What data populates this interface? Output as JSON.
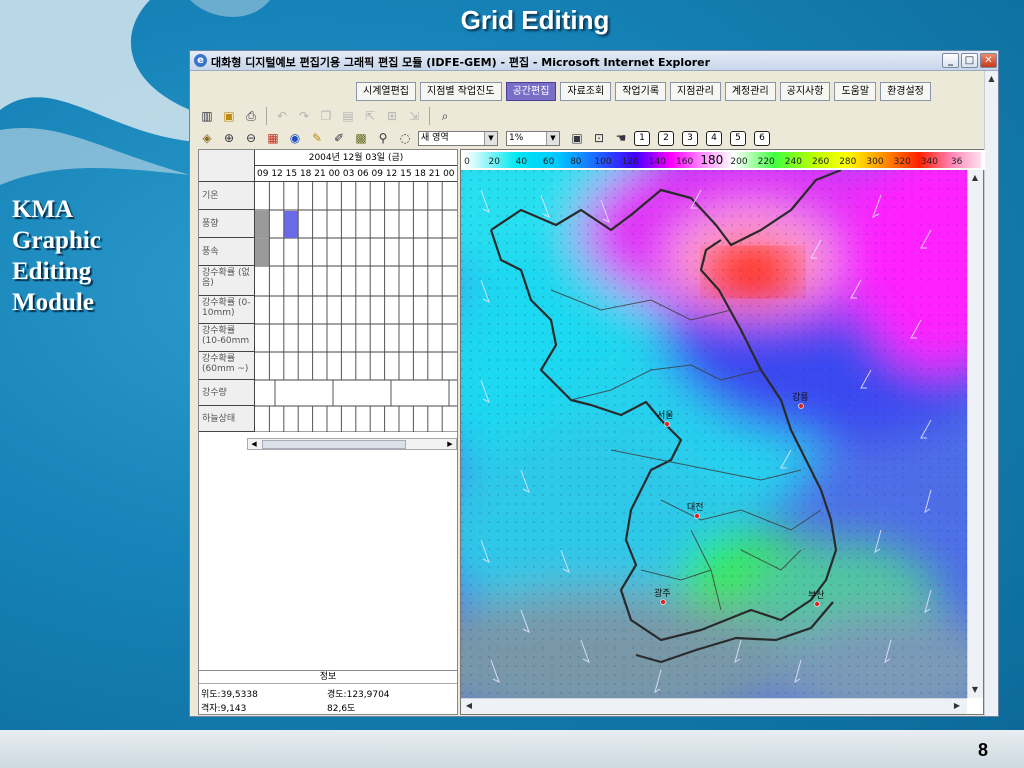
{
  "slide": {
    "title": "Grid Editing",
    "side_title_lines": [
      "KMA",
      "Graphic",
      "Editing",
      "Module"
    ],
    "page_number": "8"
  },
  "window": {
    "title": "대화형 디지털예보 편집기용 그래픽 편집 모듈 (IDFE-GEM) - 편집 - Microsoft Internet Explorer",
    "controls": {
      "minimize": "_",
      "maximize": "□",
      "close": "✕"
    }
  },
  "tabs": [
    {
      "label": "시계열편집",
      "active": false
    },
    {
      "label": "지점별 작업진도",
      "active": false
    },
    {
      "label": "공간편집",
      "active": true
    },
    {
      "label": "자료조회",
      "active": false
    },
    {
      "label": "작업기록",
      "active": false
    },
    {
      "label": "지점관리",
      "active": false
    },
    {
      "label": "계정관리",
      "active": false
    },
    {
      "label": "공지사항",
      "active": false
    },
    {
      "label": "도움말",
      "active": false
    },
    {
      "label": "환경설정",
      "active": false
    }
  ],
  "toolbar": {
    "region_select": "새 영역",
    "percent_select": "1%",
    "number_buttons": [
      "1",
      "2",
      "3",
      "4",
      "5",
      "6"
    ]
  },
  "timeseries": {
    "date": "2004년 12월 03일 (금)",
    "hours": "09 12 15 18 21 00 03 06 09 12 15 18 21 00",
    "rows": [
      {
        "label": "기온"
      },
      {
        "label": "풍향"
      },
      {
        "label": "풍속"
      },
      {
        "label": "강수확률 (없음)"
      },
      {
        "label": "강수확률 (0-10mm)"
      },
      {
        "label": "강수확률 (10-60mm"
      },
      {
        "label": "강수확률 (60mm ~)"
      },
      {
        "label": "강수량"
      },
      {
        "label": "하늘상태"
      }
    ]
  },
  "info": {
    "header": "정보",
    "lat": "위도:39,5338",
    "lon": "경도:123,9704",
    "grid": "격자:9,143",
    "value": "82,6도"
  },
  "colorbar": {
    "ticks": [
      "0",
      "20",
      "40",
      "60",
      "80",
      "100",
      "120",
      "140",
      "160",
      "180",
      "200",
      "220",
      "240",
      "260",
      "280",
      "300",
      "320",
      "340",
      "36"
    ],
    "highlight": "180"
  },
  "map": {
    "cities": [
      "서울",
      "강릉",
      "대전",
      "광주",
      "부산"
    ]
  },
  "colors": {
    "active_tab": "#7a6fc8",
    "slide_bg": "#1683b8"
  }
}
